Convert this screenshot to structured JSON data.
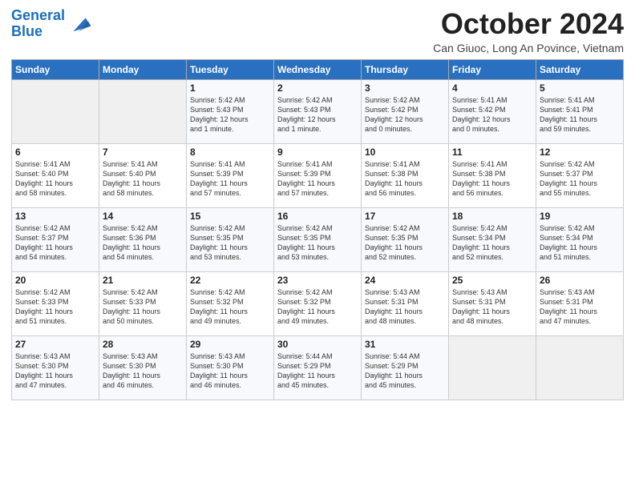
{
  "header": {
    "logo_line1": "General",
    "logo_line2": "Blue",
    "month": "October 2024",
    "location": "Can Giuoc, Long An Povince, Vietnam"
  },
  "days_of_week": [
    "Sunday",
    "Monday",
    "Tuesday",
    "Wednesday",
    "Thursday",
    "Friday",
    "Saturday"
  ],
  "weeks": [
    [
      {
        "day": "",
        "info": ""
      },
      {
        "day": "",
        "info": ""
      },
      {
        "day": "1",
        "info": "Sunrise: 5:42 AM\nSunset: 5:43 PM\nDaylight: 12 hours\nand 1 minute."
      },
      {
        "day": "2",
        "info": "Sunrise: 5:42 AM\nSunset: 5:43 PM\nDaylight: 12 hours\nand 1 minute."
      },
      {
        "day": "3",
        "info": "Sunrise: 5:42 AM\nSunset: 5:42 PM\nDaylight: 12 hours\nand 0 minutes."
      },
      {
        "day": "4",
        "info": "Sunrise: 5:41 AM\nSunset: 5:42 PM\nDaylight: 12 hours\nand 0 minutes."
      },
      {
        "day": "5",
        "info": "Sunrise: 5:41 AM\nSunset: 5:41 PM\nDaylight: 11 hours\nand 59 minutes."
      }
    ],
    [
      {
        "day": "6",
        "info": "Sunrise: 5:41 AM\nSunset: 5:40 PM\nDaylight: 11 hours\nand 58 minutes."
      },
      {
        "day": "7",
        "info": "Sunrise: 5:41 AM\nSunset: 5:40 PM\nDaylight: 11 hours\nand 58 minutes."
      },
      {
        "day": "8",
        "info": "Sunrise: 5:41 AM\nSunset: 5:39 PM\nDaylight: 11 hours\nand 57 minutes."
      },
      {
        "day": "9",
        "info": "Sunrise: 5:41 AM\nSunset: 5:39 PM\nDaylight: 11 hours\nand 57 minutes."
      },
      {
        "day": "10",
        "info": "Sunrise: 5:41 AM\nSunset: 5:38 PM\nDaylight: 11 hours\nand 56 minutes."
      },
      {
        "day": "11",
        "info": "Sunrise: 5:41 AM\nSunset: 5:38 PM\nDaylight: 11 hours\nand 56 minutes."
      },
      {
        "day": "12",
        "info": "Sunrise: 5:42 AM\nSunset: 5:37 PM\nDaylight: 11 hours\nand 55 minutes."
      }
    ],
    [
      {
        "day": "13",
        "info": "Sunrise: 5:42 AM\nSunset: 5:37 PM\nDaylight: 11 hours\nand 54 minutes."
      },
      {
        "day": "14",
        "info": "Sunrise: 5:42 AM\nSunset: 5:36 PM\nDaylight: 11 hours\nand 54 minutes."
      },
      {
        "day": "15",
        "info": "Sunrise: 5:42 AM\nSunset: 5:35 PM\nDaylight: 11 hours\nand 53 minutes."
      },
      {
        "day": "16",
        "info": "Sunrise: 5:42 AM\nSunset: 5:35 PM\nDaylight: 11 hours\nand 53 minutes."
      },
      {
        "day": "17",
        "info": "Sunrise: 5:42 AM\nSunset: 5:35 PM\nDaylight: 11 hours\nand 52 minutes."
      },
      {
        "day": "18",
        "info": "Sunrise: 5:42 AM\nSunset: 5:34 PM\nDaylight: 11 hours\nand 52 minutes."
      },
      {
        "day": "19",
        "info": "Sunrise: 5:42 AM\nSunset: 5:34 PM\nDaylight: 11 hours\nand 51 minutes."
      }
    ],
    [
      {
        "day": "20",
        "info": "Sunrise: 5:42 AM\nSunset: 5:33 PM\nDaylight: 11 hours\nand 51 minutes."
      },
      {
        "day": "21",
        "info": "Sunrise: 5:42 AM\nSunset: 5:33 PM\nDaylight: 11 hours\nand 50 minutes."
      },
      {
        "day": "22",
        "info": "Sunrise: 5:42 AM\nSunset: 5:32 PM\nDaylight: 11 hours\nand 49 minutes."
      },
      {
        "day": "23",
        "info": "Sunrise: 5:42 AM\nSunset: 5:32 PM\nDaylight: 11 hours\nand 49 minutes."
      },
      {
        "day": "24",
        "info": "Sunrise: 5:43 AM\nSunset: 5:31 PM\nDaylight: 11 hours\nand 48 minutes."
      },
      {
        "day": "25",
        "info": "Sunrise: 5:43 AM\nSunset: 5:31 PM\nDaylight: 11 hours\nand 48 minutes."
      },
      {
        "day": "26",
        "info": "Sunrise: 5:43 AM\nSunset: 5:31 PM\nDaylight: 11 hours\nand 47 minutes."
      }
    ],
    [
      {
        "day": "27",
        "info": "Sunrise: 5:43 AM\nSunset: 5:30 PM\nDaylight: 11 hours\nand 47 minutes."
      },
      {
        "day": "28",
        "info": "Sunrise: 5:43 AM\nSunset: 5:30 PM\nDaylight: 11 hours\nand 46 minutes."
      },
      {
        "day": "29",
        "info": "Sunrise: 5:43 AM\nSunset: 5:30 PM\nDaylight: 11 hours\nand 46 minutes."
      },
      {
        "day": "30",
        "info": "Sunrise: 5:44 AM\nSunset: 5:29 PM\nDaylight: 11 hours\nand 45 minutes."
      },
      {
        "day": "31",
        "info": "Sunrise: 5:44 AM\nSunset: 5:29 PM\nDaylight: 11 hours\nand 45 minutes."
      },
      {
        "day": "",
        "info": ""
      },
      {
        "day": "",
        "info": ""
      }
    ]
  ]
}
